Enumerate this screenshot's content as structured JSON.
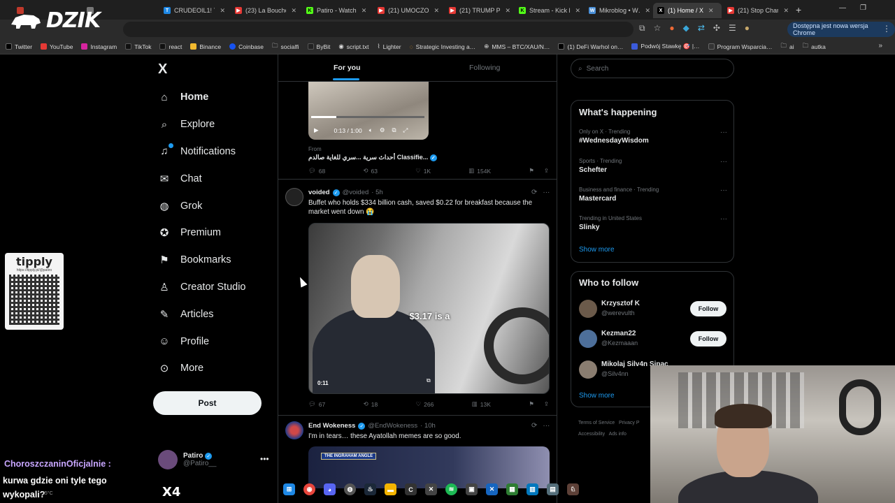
{
  "browser": {
    "tabs": [
      {
        "label": "",
        "color": "#c0392b"
      },
      {
        "label": "",
        "color": "#777"
      },
      {
        "label": "CRUDEOIL1! 7…",
        "color": "#1e88e5"
      },
      {
        "label": "(23) La Bouche",
        "color": "#e53935"
      },
      {
        "label": "Patiro - Watch",
        "color": "#53fc18"
      },
      {
        "label": "(21) UMOCZO…",
        "color": "#e53935"
      },
      {
        "label": "(21) TRUMP PC…",
        "color": "#e53935"
      },
      {
        "label": "Stream - Kick D…",
        "color": "#53fc18"
      },
      {
        "label": "Mikroblog • W…",
        "color": "#4a90d9"
      },
      {
        "label": "(1) Home / X",
        "color": "#000000"
      },
      {
        "label": "(21) Stop Chan…",
        "color": "#e53935"
      }
    ],
    "update_text": "Dostępna jest nowa wersja Chrome",
    "bookmarks": [
      {
        "label": "Twitter",
        "color": "#000"
      },
      {
        "label": "YouTube",
        "color": "#e53935"
      },
      {
        "label": "Instagram",
        "color": "#d6249f"
      },
      {
        "label": "TikTok",
        "color": "#111"
      },
      {
        "label": "react",
        "color": "#111"
      },
      {
        "label": "Binance",
        "color": "#f3ba2f"
      },
      {
        "label": "Coinbase",
        "color": "#1652f0"
      },
      {
        "label": "socialfi",
        "color": "#888"
      },
      {
        "label": "ByBit",
        "color": "#222"
      },
      {
        "label": "script.txt",
        "color": "#333"
      },
      {
        "label": "Lighter",
        "color": "#333"
      },
      {
        "label": "Strategic Investing a…",
        "color": "#f39c12"
      },
      {
        "label": "MMS – BTC/XAU/N…",
        "color": "#555"
      },
      {
        "label": "(1) DeFi Warhol on…",
        "color": "#000"
      },
      {
        "label": "Podwój Stawkę 🎯 |…",
        "color": "#3b5bdb"
      },
      {
        "label": "Program Wsparcia…",
        "color": "#333"
      },
      {
        "label": "ai",
        "color": "#888"
      },
      {
        "label": "autka",
        "color": "#888"
      }
    ]
  },
  "overlay": {
    "brand": "DZIK",
    "tipply_title": "tipply",
    "tipply_url": "https://tipply.pl/@patiro",
    "chat_user": "ChoroszczaninOficjalnie :",
    "chat_message": "kurwa gdzie oni tyle tego wykopali?",
    "x4": "X4",
    "weather": "15°C"
  },
  "x": {
    "logo": "X",
    "nav": [
      {
        "label": "Home",
        "icon": "home-icon",
        "glyph": "⌂"
      },
      {
        "label": "Explore",
        "icon": "search-icon",
        "glyph": "⌕"
      },
      {
        "label": "Notifications",
        "icon": "bell-icon",
        "glyph": "🔔"
      },
      {
        "label": "Chat",
        "icon": "mail-icon",
        "glyph": "✉"
      },
      {
        "label": "Grok",
        "icon": "grok-icon",
        "glyph": "◍"
      },
      {
        "label": "Premium",
        "icon": "premium-icon",
        "glyph": "✪"
      },
      {
        "label": "Bookmarks",
        "icon": "bookmark-icon",
        "glyph": "🔖"
      },
      {
        "label": "Creator Studio",
        "icon": "creator-icon",
        "glyph": "♙"
      },
      {
        "label": "Articles",
        "icon": "articles-icon",
        "glyph": "✎"
      },
      {
        "label": "Profile",
        "icon": "profile-icon",
        "glyph": "👤"
      },
      {
        "label": "More",
        "icon": "more-icon",
        "glyph": "⋯"
      }
    ],
    "post_button": "Post",
    "account": {
      "name": "Patiro",
      "handle": "@Patiro__"
    },
    "timeline_tabs": {
      "for_you": "For you",
      "following": "Following"
    },
    "post0": {
      "video_time": "0:13 / 1:00",
      "progress": 0.22,
      "from_label": "From",
      "from_source": "أحداث سرية ...سري للغاية صالدم Classifie...",
      "stats": {
        "replies": "68",
        "reposts": "63",
        "likes": "1K",
        "views": "154K"
      }
    },
    "post1": {
      "name": "voided",
      "handle": "@voided",
      "time": "· 5h",
      "text": "Buffet who holds $334 billion cash, saved $0.22 for breakfast because the market went down 😭",
      "video_caption": "$3.17 is a",
      "video_time": "0:11",
      "stats": {
        "replies": "67",
        "reposts": "18",
        "likes": "266",
        "views": "13K"
      }
    },
    "post2": {
      "name": "End Wokeness",
      "handle": "@EndWokeness",
      "time": "· 10h",
      "text": "I'm in tears… these Ayatollah memes are so good.",
      "banner": "THE INGRAHAM ANGLE"
    },
    "search_placeholder": "Search",
    "whats_happening": {
      "title": "What's happening",
      "trends": [
        {
          "meta": "Only on X · Trending",
          "name": "#WednesdayWisdom"
        },
        {
          "meta": "Sports · Trending",
          "name": "Schefter"
        },
        {
          "meta": "Business and finance · Trending",
          "name": "Mastercard"
        },
        {
          "meta": "Trending in United States",
          "name": "Slinky"
        }
      ],
      "show_more": "Show more"
    },
    "who_to_follow": {
      "title": "Who to follow",
      "users": [
        {
          "name": "Krzysztof K",
          "handle": "@werevulth",
          "button": "Follow"
        },
        {
          "name": "Kezman22",
          "handle": "@Kezmaaan",
          "button": "Follow"
        },
        {
          "name": "Mikolaj Silv4n Sipac",
          "handle": "@Silv4nn",
          "button": ""
        }
      ],
      "show_more": "Show more"
    },
    "footer": {
      "terms": "Terms of Service",
      "privacy": "Privacy P",
      "accessibility": "Accessibility",
      "ads": "Ads info"
    }
  }
}
